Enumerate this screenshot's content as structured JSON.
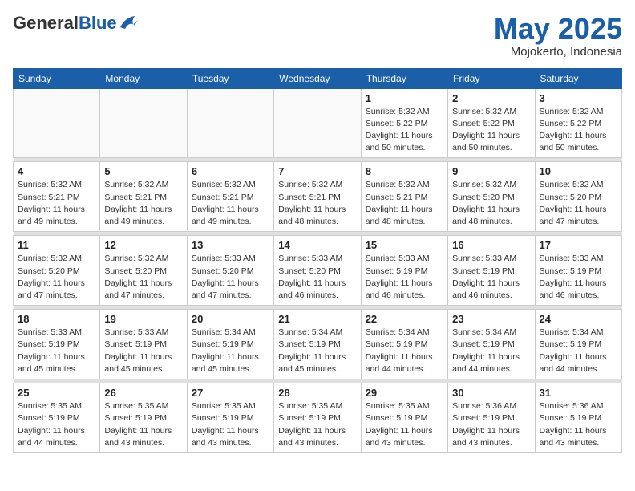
{
  "header": {
    "logo_general": "General",
    "logo_blue": "Blue",
    "month": "May 2025",
    "location": "Mojokerto, Indonesia"
  },
  "weekdays": [
    "Sunday",
    "Monday",
    "Tuesday",
    "Wednesday",
    "Thursday",
    "Friday",
    "Saturday"
  ],
  "weeks": [
    [
      {
        "day": "",
        "info": ""
      },
      {
        "day": "",
        "info": ""
      },
      {
        "day": "",
        "info": ""
      },
      {
        "day": "",
        "info": ""
      },
      {
        "day": "1",
        "info": "Sunrise: 5:32 AM\nSunset: 5:22 PM\nDaylight: 11 hours\nand 50 minutes."
      },
      {
        "day": "2",
        "info": "Sunrise: 5:32 AM\nSunset: 5:22 PM\nDaylight: 11 hours\nand 50 minutes."
      },
      {
        "day": "3",
        "info": "Sunrise: 5:32 AM\nSunset: 5:22 PM\nDaylight: 11 hours\nand 50 minutes."
      }
    ],
    [
      {
        "day": "4",
        "info": "Sunrise: 5:32 AM\nSunset: 5:21 PM\nDaylight: 11 hours\nand 49 minutes."
      },
      {
        "day": "5",
        "info": "Sunrise: 5:32 AM\nSunset: 5:21 PM\nDaylight: 11 hours\nand 49 minutes."
      },
      {
        "day": "6",
        "info": "Sunrise: 5:32 AM\nSunset: 5:21 PM\nDaylight: 11 hours\nand 49 minutes."
      },
      {
        "day": "7",
        "info": "Sunrise: 5:32 AM\nSunset: 5:21 PM\nDaylight: 11 hours\nand 48 minutes."
      },
      {
        "day": "8",
        "info": "Sunrise: 5:32 AM\nSunset: 5:21 PM\nDaylight: 11 hours\nand 48 minutes."
      },
      {
        "day": "9",
        "info": "Sunrise: 5:32 AM\nSunset: 5:20 PM\nDaylight: 11 hours\nand 48 minutes."
      },
      {
        "day": "10",
        "info": "Sunrise: 5:32 AM\nSunset: 5:20 PM\nDaylight: 11 hours\nand 47 minutes."
      }
    ],
    [
      {
        "day": "11",
        "info": "Sunrise: 5:32 AM\nSunset: 5:20 PM\nDaylight: 11 hours\nand 47 minutes."
      },
      {
        "day": "12",
        "info": "Sunrise: 5:32 AM\nSunset: 5:20 PM\nDaylight: 11 hours\nand 47 minutes."
      },
      {
        "day": "13",
        "info": "Sunrise: 5:33 AM\nSunset: 5:20 PM\nDaylight: 11 hours\nand 47 minutes."
      },
      {
        "day": "14",
        "info": "Sunrise: 5:33 AM\nSunset: 5:20 PM\nDaylight: 11 hours\nand 46 minutes."
      },
      {
        "day": "15",
        "info": "Sunrise: 5:33 AM\nSunset: 5:19 PM\nDaylight: 11 hours\nand 46 minutes."
      },
      {
        "day": "16",
        "info": "Sunrise: 5:33 AM\nSunset: 5:19 PM\nDaylight: 11 hours\nand 46 minutes."
      },
      {
        "day": "17",
        "info": "Sunrise: 5:33 AM\nSunset: 5:19 PM\nDaylight: 11 hours\nand 46 minutes."
      }
    ],
    [
      {
        "day": "18",
        "info": "Sunrise: 5:33 AM\nSunset: 5:19 PM\nDaylight: 11 hours\nand 45 minutes."
      },
      {
        "day": "19",
        "info": "Sunrise: 5:33 AM\nSunset: 5:19 PM\nDaylight: 11 hours\nand 45 minutes."
      },
      {
        "day": "20",
        "info": "Sunrise: 5:34 AM\nSunset: 5:19 PM\nDaylight: 11 hours\nand 45 minutes."
      },
      {
        "day": "21",
        "info": "Sunrise: 5:34 AM\nSunset: 5:19 PM\nDaylight: 11 hours\nand 45 minutes."
      },
      {
        "day": "22",
        "info": "Sunrise: 5:34 AM\nSunset: 5:19 PM\nDaylight: 11 hours\nand 44 minutes."
      },
      {
        "day": "23",
        "info": "Sunrise: 5:34 AM\nSunset: 5:19 PM\nDaylight: 11 hours\nand 44 minutes."
      },
      {
        "day": "24",
        "info": "Sunrise: 5:34 AM\nSunset: 5:19 PM\nDaylight: 11 hours\nand 44 minutes."
      }
    ],
    [
      {
        "day": "25",
        "info": "Sunrise: 5:35 AM\nSunset: 5:19 PM\nDaylight: 11 hours\nand 44 minutes."
      },
      {
        "day": "26",
        "info": "Sunrise: 5:35 AM\nSunset: 5:19 PM\nDaylight: 11 hours\nand 43 minutes."
      },
      {
        "day": "27",
        "info": "Sunrise: 5:35 AM\nSunset: 5:19 PM\nDaylight: 11 hours\nand 43 minutes."
      },
      {
        "day": "28",
        "info": "Sunrise: 5:35 AM\nSunset: 5:19 PM\nDaylight: 11 hours\nand 43 minutes."
      },
      {
        "day": "29",
        "info": "Sunrise: 5:35 AM\nSunset: 5:19 PM\nDaylight: 11 hours\nand 43 minutes."
      },
      {
        "day": "30",
        "info": "Sunrise: 5:36 AM\nSunset: 5:19 PM\nDaylight: 11 hours\nand 43 minutes."
      },
      {
        "day": "31",
        "info": "Sunrise: 5:36 AM\nSunset: 5:19 PM\nDaylight: 11 hours\nand 43 minutes."
      }
    ]
  ]
}
